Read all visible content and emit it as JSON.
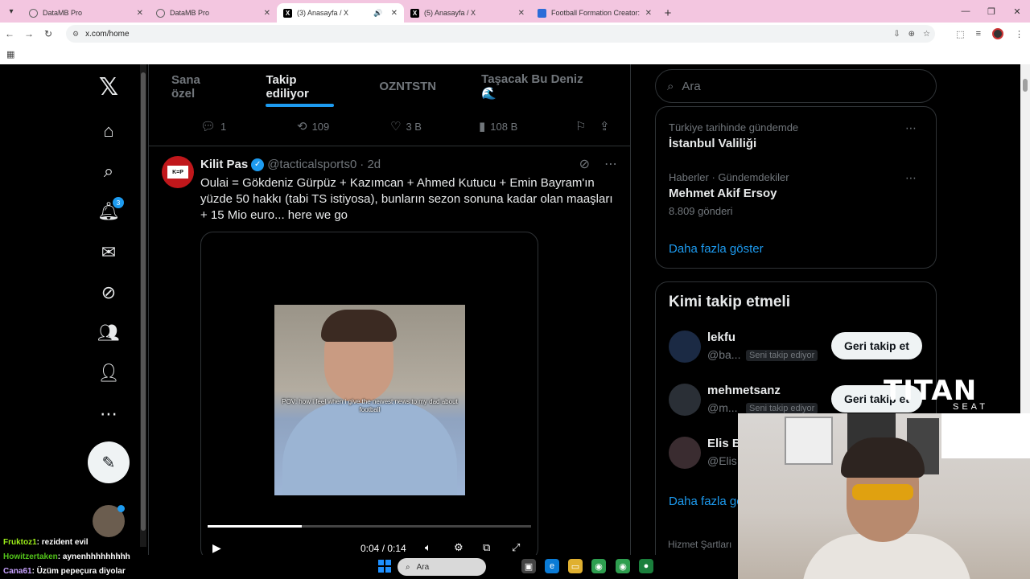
{
  "browser": {
    "tabs": [
      {
        "label": "DataMB Pro",
        "active": false
      },
      {
        "label": "DataMB Pro",
        "active": false
      },
      {
        "label": "(3) Anasayfa / X",
        "active": true
      },
      {
        "label": "(5) Anasayfa / X",
        "active": false
      },
      {
        "label": "Football Formation Creator: Re",
        "active": false
      }
    ],
    "url": "x.com/home"
  },
  "timeline_tabs": [
    "Sana özel",
    "Takip ediliyor",
    "OZNTSTN",
    "Taşacak Bu Deniz🌊"
  ],
  "prev_tweet_actions": {
    "replies": "1",
    "reposts": "109",
    "likes": "3 B",
    "views": "108 B"
  },
  "nav": {
    "notification_count": "3"
  },
  "tweet": {
    "name": "Kilit Pas",
    "handle": "@tacticalsports0",
    "time": "· 2d",
    "avatar_text": "K=P",
    "text": "Oulai = Gökdeniz Gürpüz + Kazımcan + Ahmed Kutucu + Emin Bayram'ın yüzde 50 hakkı (tabi TS istiyosa), bunların sezon sonuna kadar olan maaşları + 15 Mio euro... here we go",
    "video_caption": "POV: how i feel when i give the newest news to my dad about football",
    "video_time": "0:04 / 0:14",
    "progress": 0.29
  },
  "search": {
    "placeholder": "Ara"
  },
  "trends": [
    {
      "meta": "Türkiye tarihinde gündemde",
      "title": "İstanbul Valiliği",
      "count": ""
    },
    {
      "meta": "Haberler · Gündemdekiler",
      "title": "Mehmet Akif Ersoy",
      "count": "8.809 gönderi"
    }
  ],
  "trends_show_more": "Daha fazla göster",
  "who_to_follow": {
    "title": "Kimi takip etmeli",
    "users": [
      {
        "name": "lekfu",
        "handle": "@ba...",
        "follows_you": "Seni takip ediyor",
        "button": "Geri takip et"
      },
      {
        "name": "mehmetsanz",
        "handle": "@m...",
        "follows_you": "Seni takip ediyor",
        "button": "Geri takip et"
      },
      {
        "name": "Elis B",
        "handle": "@Elis",
        "follows_you": "",
        "button": ""
      }
    ],
    "show_more": "Daha fazla gö"
  },
  "footer": "Hizmet Şartları",
  "overlay": {
    "brand": "TITAN",
    "brand_sub": "SEAT",
    "chat": [
      {
        "user": "Fruktoz1",
        "message": ": rezident evil"
      },
      {
        "user": "Howitzertaken",
        "message": ": aynenhhhhhhhhh"
      },
      {
        "user": "Cana61",
        "message": ": Üzüm pepeçura diyolar"
      }
    ]
  },
  "taskbar": {
    "search": "Ara"
  }
}
